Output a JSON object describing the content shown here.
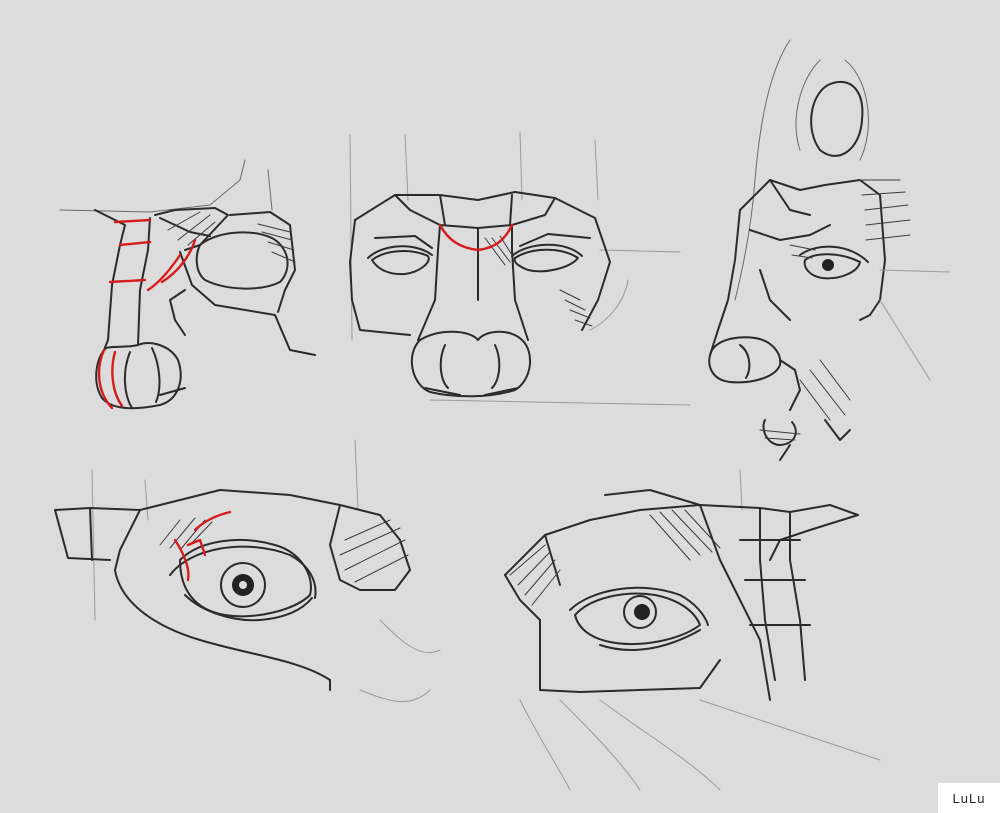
{
  "signature": {
    "text": "LuLu"
  },
  "colors": {
    "background": "#dcdcdd",
    "line": "#2b2b2b",
    "construction_red": "#d51c1c",
    "signature_bg": "#ffffff"
  },
  "icons": {
    "sketch": "sketch-illustration"
  }
}
